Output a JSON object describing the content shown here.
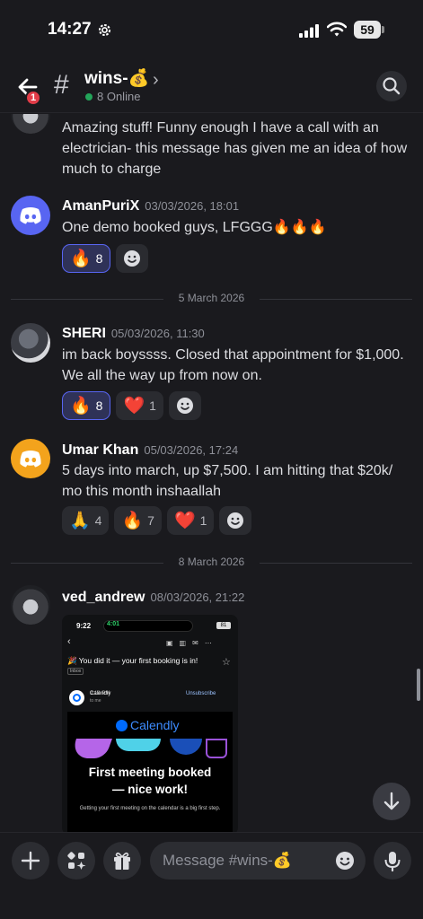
{
  "status_bar": {
    "time": "14:27",
    "battery": "59"
  },
  "header": {
    "channel_name": "wins-💰",
    "online": "8 Online",
    "notification_count": "1"
  },
  "messages": [
    {
      "text": "Amazing stuff! Funny enough I have a  call with an electrician- this message has given me an idea of how much to charge"
    },
    {
      "author": "AmanPuriX",
      "timestamp": "03/03/2026, 18:01",
      "text": "One demo booked guys, LFGGG🔥🔥🔥",
      "reactions": [
        {
          "emoji": "🔥",
          "count": "8"
        }
      ]
    },
    {
      "author": "SHERI",
      "timestamp": "05/03/2026, 11:30",
      "text": "im back boyssss. Closed that appointment for $1,000. We all the way up from now on.",
      "reactions": [
        {
          "emoji": "🔥",
          "count": "8"
        },
        {
          "emoji": "❤️",
          "count": "1"
        }
      ]
    },
    {
      "author": "Umar Khan",
      "timestamp": "05/03/2026, 17:24",
      "text": "5 days into march, up $7,500. I am hitting that $20k/ mo this month inshaallah",
      "reactions": [
        {
          "emoji": "🙏",
          "count": "4"
        },
        {
          "emoji": "🔥",
          "count": "7"
        },
        {
          "emoji": "❤️",
          "count": "1"
        }
      ]
    },
    {
      "author": "ved_andrew",
      "timestamp": "08/03/2026, 21:22"
    }
  ],
  "dividers": [
    "5 March 2026",
    "8 March 2026"
  ],
  "attachment": {
    "time": "9:22",
    "call": "4:01",
    "battery": "81",
    "subject": "🎉 You did it — your first booking is in!",
    "inbox_tag": "Inbox",
    "sender": "Calendly",
    "sent_time": "9:13 PM",
    "to": "to me",
    "unsubscribe": "Unsubscribe",
    "logo": "Calendly",
    "headline_1": "First meeting booked",
    "headline_2": "— nice work!",
    "footer": "Getting your first meeting on the calendar is a big first step."
  },
  "composer": {
    "placeholder": "Message #wins-💰"
  }
}
